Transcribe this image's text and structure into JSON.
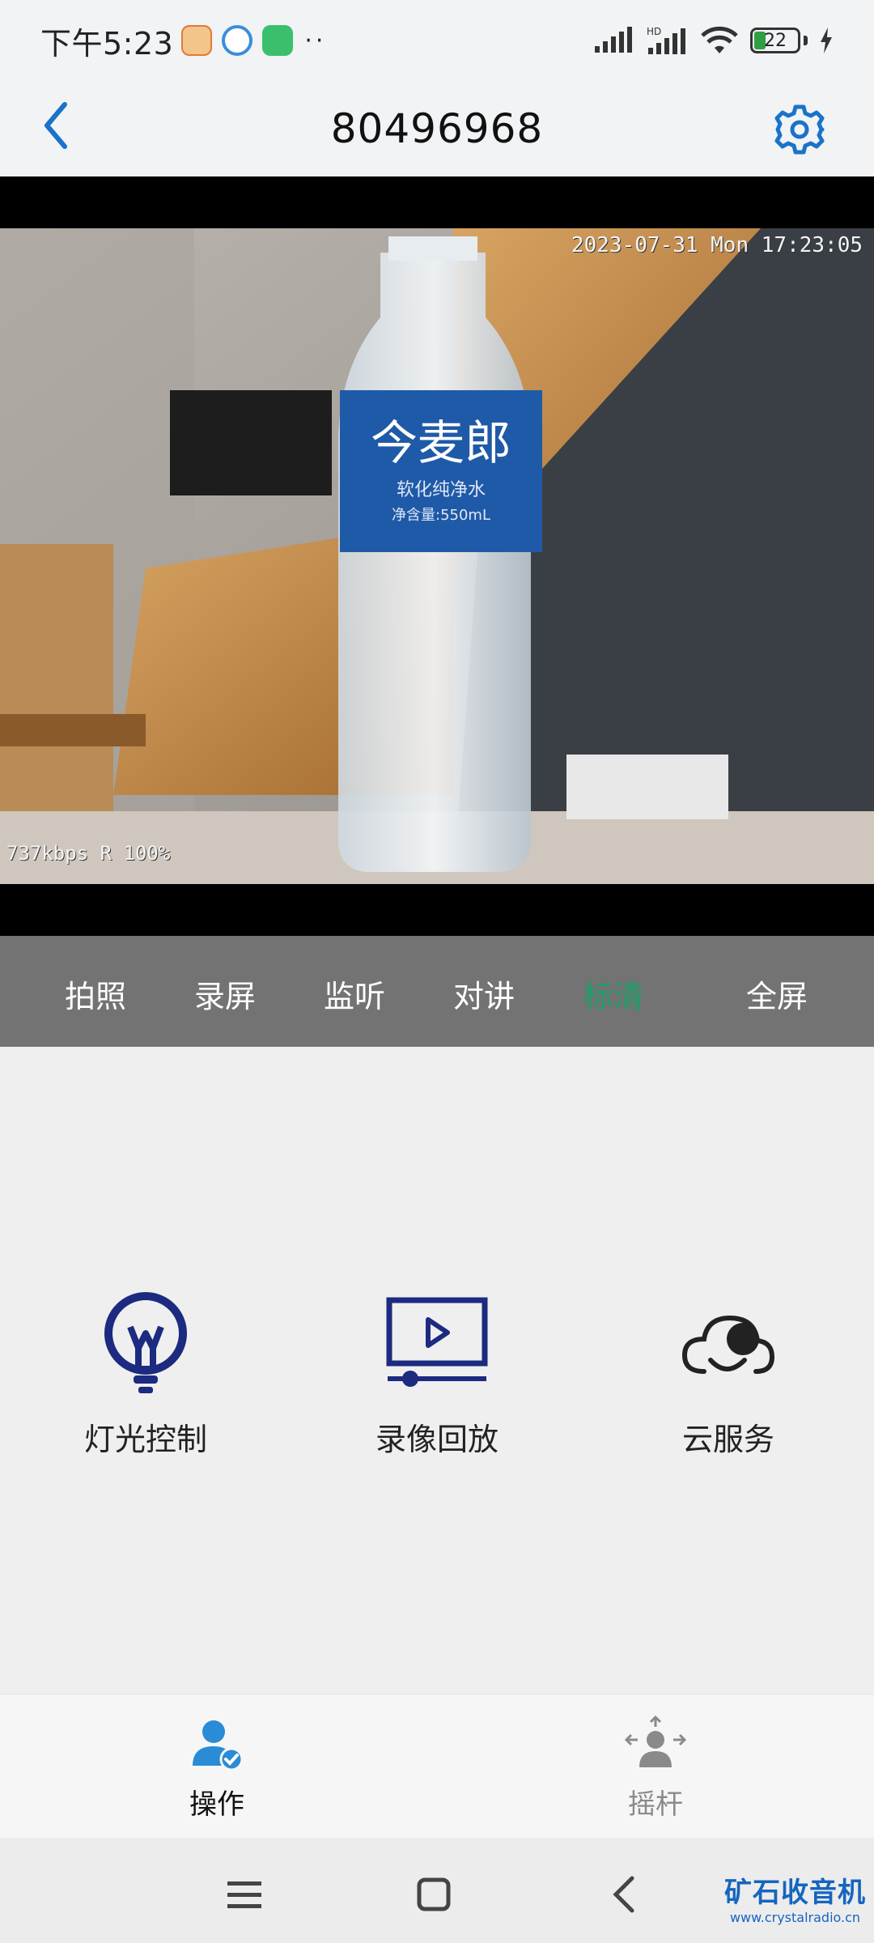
{
  "status_bar": {
    "time": "下午5:23",
    "dots": "··",
    "battery_level": "22",
    "app_icons": [
      "app-icon-1",
      "app-icon-2",
      "app-icon-3"
    ]
  },
  "header": {
    "title": "80496968",
    "back_icon": "chevron-left-icon",
    "settings_icon": "gear-icon",
    "accent": "#1a73c9"
  },
  "video": {
    "timestamp": "2023-07-31 Mon 17:23:05",
    "bitrate": "737kbps R 100%",
    "bottle_label": "今麦郎",
    "bottle_subtext": "软化纯净水",
    "bottle_volume": "净含量:550mL"
  },
  "controls": {
    "items": [
      {
        "label": "拍照",
        "active": false
      },
      {
        "label": "录屏",
        "active": false
      },
      {
        "label": "监听",
        "active": false
      },
      {
        "label": "对讲",
        "active": false
      },
      {
        "label": "标清",
        "active": true
      },
      {
        "label": "全屏",
        "active": false
      }
    ],
    "active_color": "#1e9e6a"
  },
  "features": [
    {
      "label": "灯光控制",
      "icon": "lightbulb-icon"
    },
    {
      "label": "录像回放",
      "icon": "video-playback-icon"
    },
    {
      "label": "云服务",
      "icon": "cloud-icon"
    }
  ],
  "tabs": [
    {
      "label": "操作",
      "icon": "user-check-icon",
      "active": true
    },
    {
      "label": "摇杆",
      "icon": "joystick-icon",
      "active": false
    }
  ],
  "navbar": {
    "watermark_main": "矿石收音机",
    "watermark_sub": "www.crystalradio.cn"
  }
}
